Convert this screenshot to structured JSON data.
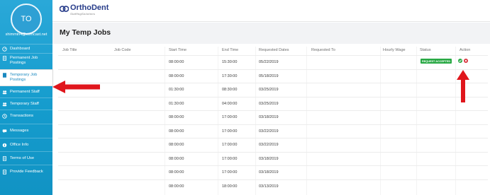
{
  "user": {
    "initials": "TO",
    "email": "shimmin4@comcast.net"
  },
  "nav": [
    {
      "label": "Dashboard",
      "icon": "dashboard-icon"
    },
    {
      "label": "Permanent Job Postings",
      "icon": "document-icon"
    },
    {
      "label": "Temporary Job Postings",
      "icon": "document-icon",
      "active": true
    },
    {
      "label": "Permanent Staff",
      "icon": "people-icon"
    },
    {
      "label": "Temporary Staff",
      "icon": "people-icon"
    },
    {
      "label": "Transactions",
      "icon": "clock-icon"
    },
    {
      "label": "Messages",
      "icon": "chat-icon"
    },
    {
      "label": "Office Info",
      "icon": "info-icon"
    },
    {
      "label": "Terms of Use",
      "icon": "document-icon"
    },
    {
      "label": "Provide Feedback",
      "icon": "document-icon"
    }
  ],
  "logo": {
    "part1": "Ortho",
    "part2": "Dent",
    "tagline": "StaffingSolutions"
  },
  "page": {
    "title": "My Temp Jobs"
  },
  "table": {
    "headers": [
      "Job Title",
      "Job Code",
      "Start Time",
      "End Time",
      "Requested Dates",
      "Requested To",
      "Hourly Wage",
      "Status",
      "Action"
    ],
    "rows": [
      {
        "start": "08:00:00",
        "end": "15:30:00",
        "date": "05/22/2019",
        "status": "REQUEST ACCEPTED",
        "actions": true
      },
      {
        "start": "08:00:00",
        "end": "17:30:00",
        "date": "05/18/2019"
      },
      {
        "start": "01:30:00",
        "end": "08:30:00",
        "date": "03/25/2019"
      },
      {
        "start": "01:30:00",
        "end": "04:00:00",
        "date": "03/25/2019"
      },
      {
        "start": "08:00:00",
        "end": "17:00:00",
        "date": "03/18/2019"
      },
      {
        "start": "08:00:00",
        "end": "17:00:00",
        "date": "03/22/2019"
      },
      {
        "start": "08:00:00",
        "end": "17:00:00",
        "date": "03/22/2019"
      },
      {
        "start": "08:00:00",
        "end": "17:00:00",
        "date": "03/18/2019"
      },
      {
        "start": "08:00:00",
        "end": "17:00:00",
        "date": "03/18/2019"
      },
      {
        "start": "08:00:00",
        "end": "18:00:00",
        "date": "03/13/2019"
      }
    ]
  },
  "colors": {
    "sidebar": "#159ccd",
    "accept": "#27a843",
    "reject": "#d8323c",
    "arrow": "#e0161c",
    "brand": "#273c8a"
  }
}
